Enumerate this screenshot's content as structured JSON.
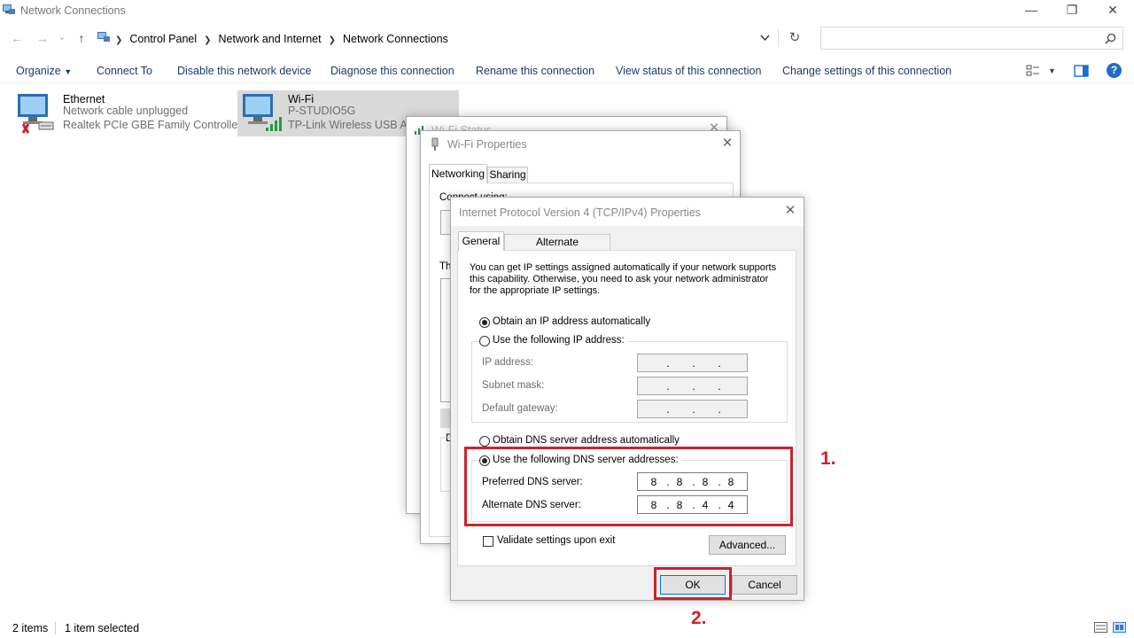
{
  "window": {
    "title": "Network Connections",
    "minimize": "—",
    "restore": "❐",
    "close": "✕"
  },
  "nav": {
    "back": "←",
    "forward": "→",
    "recent": "⌄",
    "up": "↑",
    "refresh": "↻"
  },
  "address": {
    "crumbs": [
      "Control Panel",
      "Network and Internet",
      "Network Connections"
    ],
    "search_placeholder": ""
  },
  "commands": {
    "organize": "Organize",
    "connect_to": "Connect To",
    "disable": "Disable this network device",
    "diagnose": "Diagnose this connection",
    "rename": "Rename this connection",
    "view_status": "View status of this connection",
    "change_settings": "Change settings of this connection",
    "help": "?"
  },
  "connections": [
    {
      "name": "Ethernet",
      "status": "Network cable unplugged",
      "device": "Realtek PCIe GBE Family Controller"
    },
    {
      "name": "Wi-Fi",
      "status": "P-STUDIO5G",
      "device": "TP-Link Wireless USB Ada"
    }
  ],
  "statusbar": {
    "items": "2 items",
    "selected": "1 item selected"
  },
  "wifi_status": {
    "title": "Wi-Fi Status"
  },
  "wifi_props": {
    "title": "Wi-Fi Properties",
    "tabs": [
      "Networking",
      "Sharing"
    ],
    "connect_using": "Connect using:",
    "list_label": "Th",
    "desc_label": "D"
  },
  "ipv4": {
    "title": "Internet Protocol Version 4 (TCP/IPv4) Properties",
    "tabs": [
      "General",
      "Alternate Configuration"
    ],
    "intro": "You can get IP settings assigned automatically if your network supports this capability. Otherwise, you need to ask your network administrator for the appropriate IP settings.",
    "ip_auto": "Obtain an IP address automatically",
    "ip_manual": "Use the following IP address:",
    "ip_address": "IP address:",
    "subnet": "Subnet mask:",
    "gateway": "Default gateway:",
    "dns_auto": "Obtain DNS server address automatically",
    "dns_manual": "Use the following DNS server addresses:",
    "preferred": "Preferred DNS server:",
    "alternate": "Alternate DNS server:",
    "preferred_octets": [
      "8",
      "8",
      "8",
      "8"
    ],
    "alternate_octets": [
      "8",
      "8",
      "4",
      "4"
    ],
    "validate": "Validate settings upon exit",
    "advanced": "Advanced...",
    "ok": "OK",
    "cancel": "Cancel"
  },
  "annotations": {
    "step1": "1.",
    "step2": "2."
  },
  "colors": {
    "highlight": "#d0202e",
    "selection": "#d9d9d9",
    "command_text": "#1a3b6b"
  }
}
